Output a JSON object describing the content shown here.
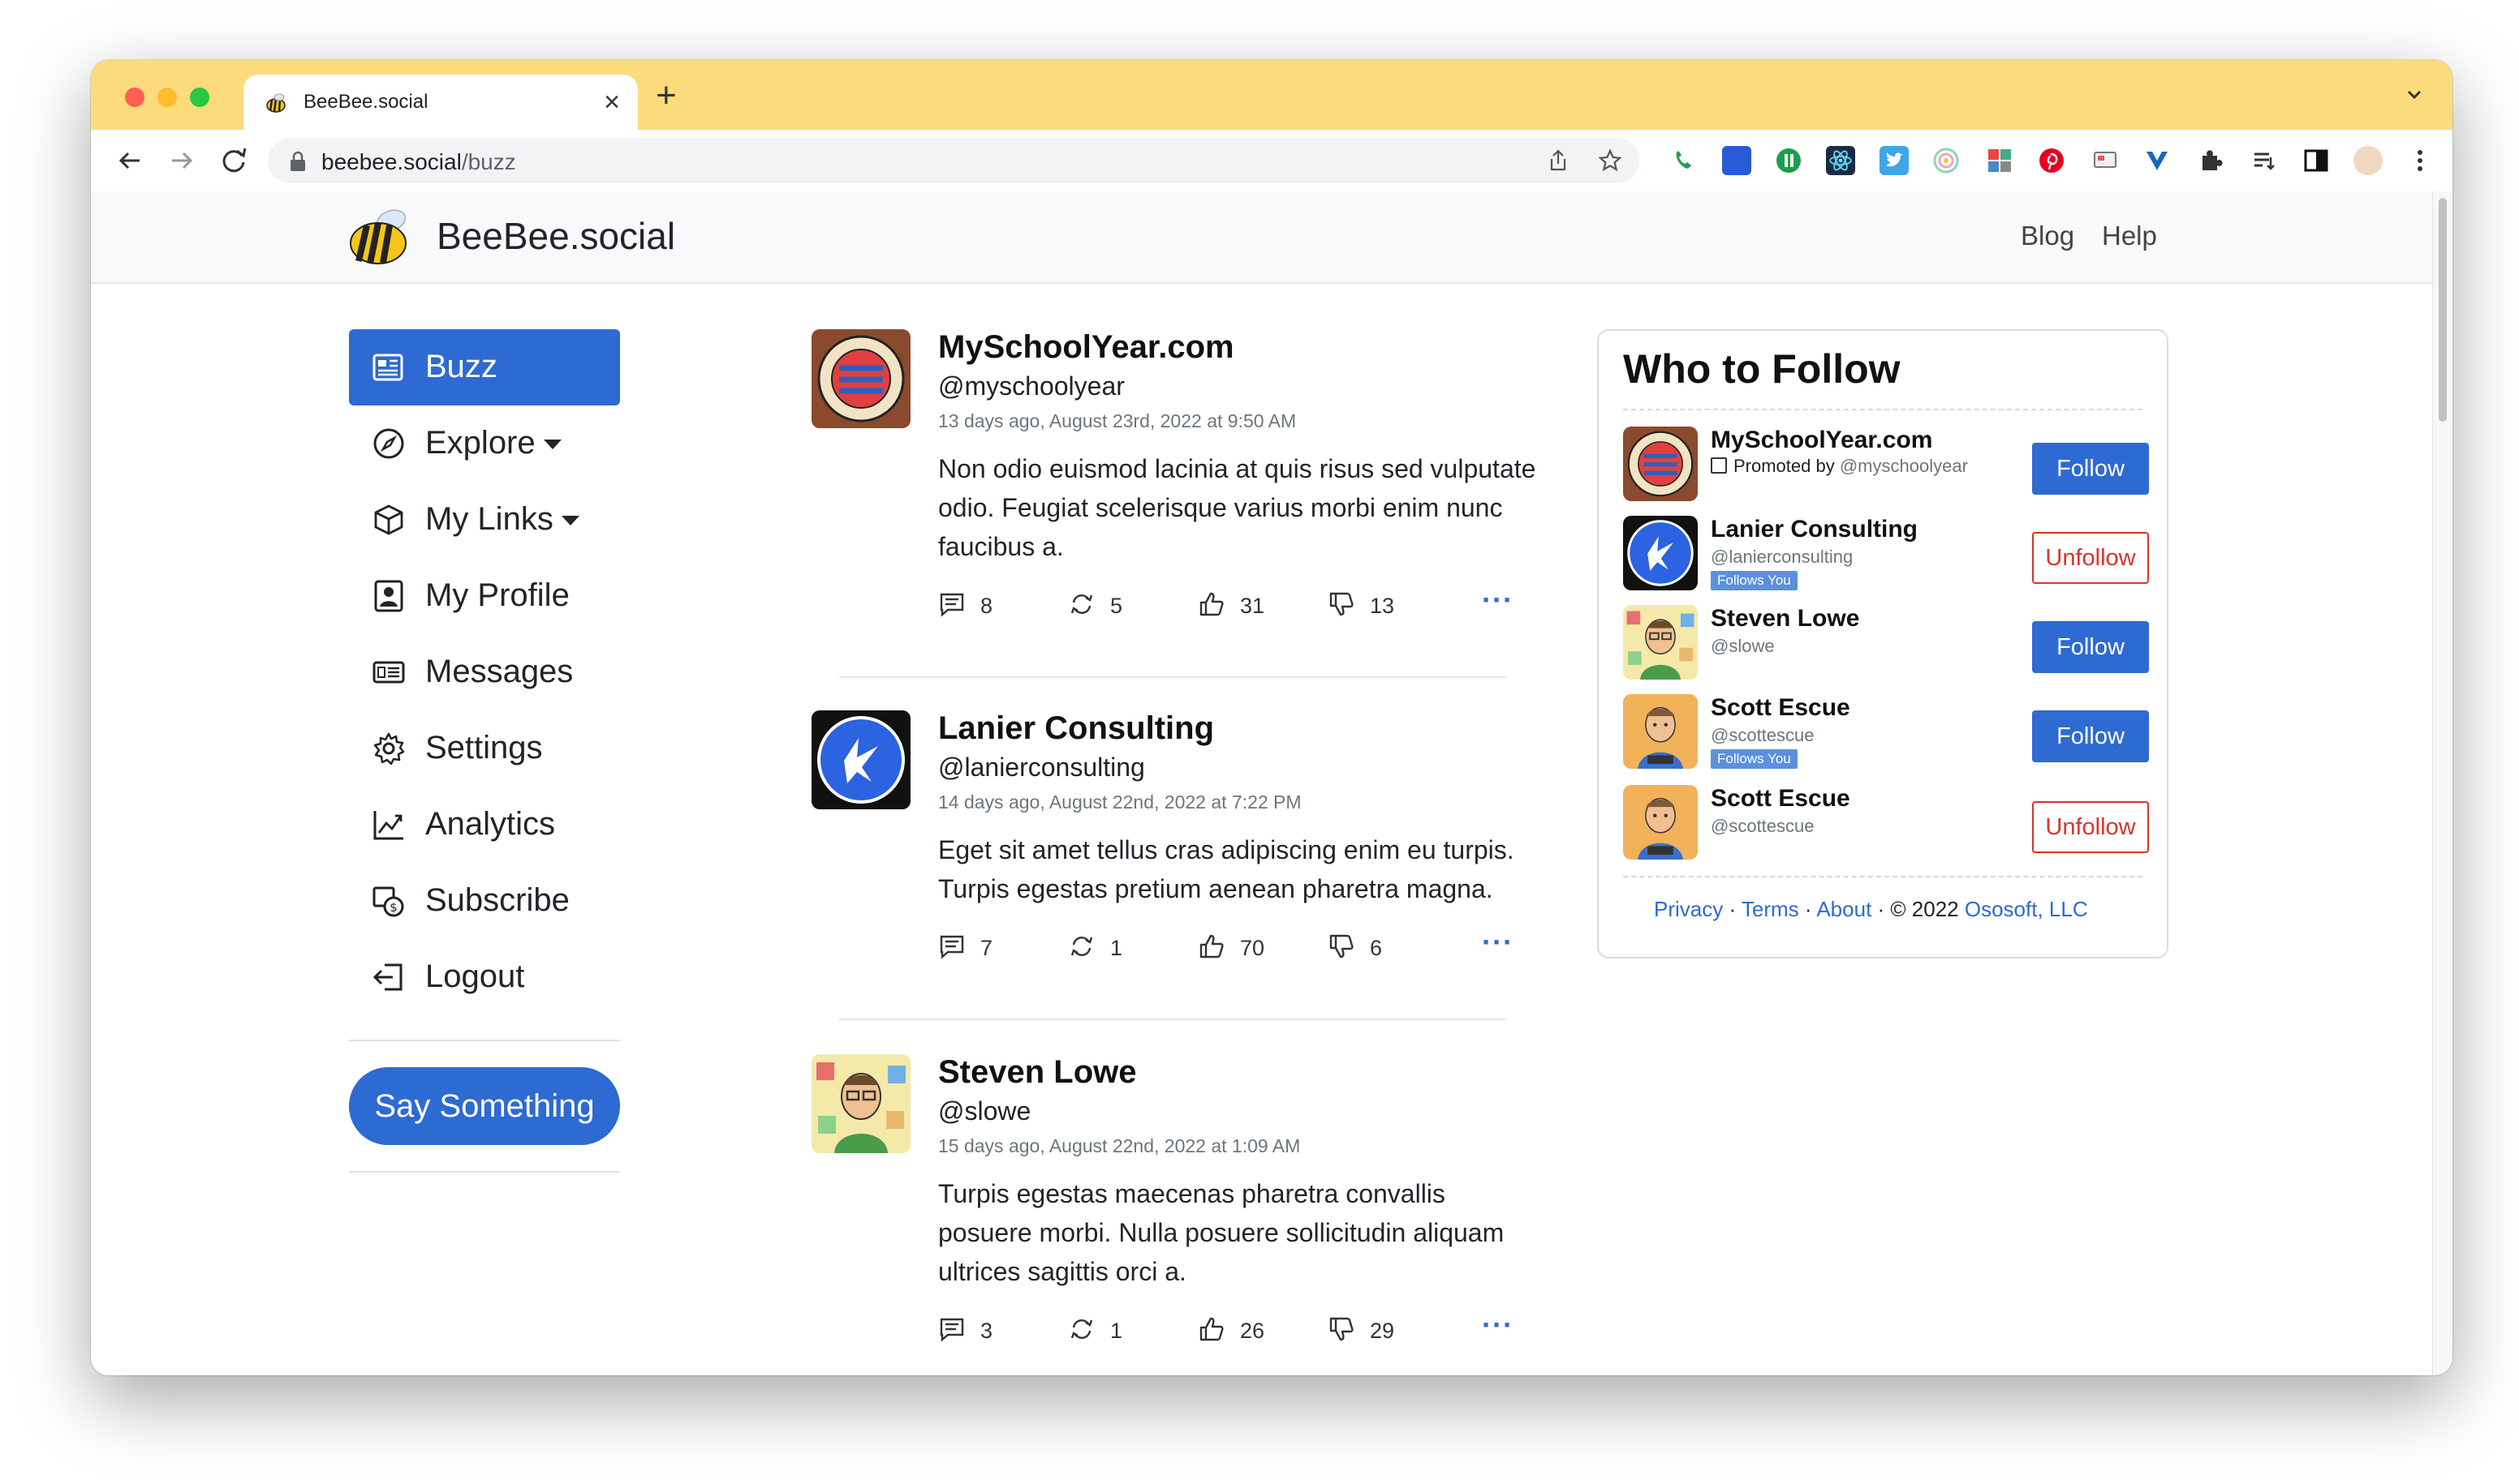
{
  "browser": {
    "tab_title": "BeeBee.social",
    "tab_close": "×",
    "new_tab": "+",
    "url_host": "beebee.social",
    "url_path": "/buzz"
  },
  "navbar": {
    "brand": "BeeBee.social",
    "links": [
      "Blog",
      "Help"
    ]
  },
  "sidebar": {
    "items": [
      {
        "label": "Buzz",
        "icon": "newspaper-icon",
        "active": true
      },
      {
        "label": "Explore",
        "icon": "compass-icon",
        "dropdown": true
      },
      {
        "label": "My Links",
        "icon": "box-icon",
        "dropdown": true
      },
      {
        "label": "My Profile",
        "icon": "person-badge-icon"
      },
      {
        "label": "Messages",
        "icon": "messages-icon"
      },
      {
        "label": "Settings",
        "icon": "gear-icon"
      },
      {
        "label": "Analytics",
        "icon": "chart-line-icon"
      },
      {
        "label": "Subscribe",
        "icon": "subscribe-icon"
      },
      {
        "label": "Logout",
        "icon": "logout-icon"
      }
    ],
    "cta": "Say Something"
  },
  "feed": {
    "posts": [
      {
        "name": "MySchoolYear.com",
        "handle": "@myschoolyear",
        "time": "13 days ago, August 23rd, 2022 at 9:50 AM",
        "body": "Non odio euismod lacinia at quis risus sed vulputate odio. Feugiat scelerisque varius morbi enim nunc faucibus a.",
        "comments": "8",
        "reposts": "5",
        "likes": "31",
        "dislikes": "13"
      },
      {
        "name": "Lanier Consulting",
        "handle": "@lanierconsulting",
        "time": "14 days ago, August 22nd, 2022 at 7:22 PM",
        "body": "Eget sit amet tellus cras adipiscing enim eu turpis. Turpis egestas pretium aenean pharetra magna.",
        "comments": "7",
        "reposts": "1",
        "likes": "70",
        "dislikes": "6"
      },
      {
        "name": "Steven Lowe",
        "handle": "@slowe",
        "time": "15 days ago, August 22nd, 2022 at 1:09 AM",
        "body": "Turpis egestas maecenas pharetra convallis posuere morbi. Nulla posuere sollicitudin aliquam ultrices sagittis orci a.",
        "comments": "3",
        "reposts": "1",
        "likes": "26",
        "dislikes": "29"
      }
    ],
    "more": "···"
  },
  "who_to_follow": {
    "title": "Who to Follow",
    "suggestions": [
      {
        "name": "MySchoolYear.com",
        "promoted_prefix": "Promoted by ",
        "handle": "@myschoolyear",
        "follows_you": "",
        "button": "Follow"
      },
      {
        "name": "Lanier Consulting",
        "handle": "@lanierconsulting",
        "follows_you": "Follows You",
        "button": "Unfollow"
      },
      {
        "name": "Steven Lowe",
        "handle": "@slowe",
        "follows_you": "",
        "button": "Follow"
      },
      {
        "name": "Scott Escue",
        "handle": "@scottescue",
        "follows_you": "Follows You",
        "button": "Follow"
      },
      {
        "name": "Scott Escue",
        "handle": "@scottescue",
        "follows_you": "",
        "button": "Unfollow"
      }
    ],
    "footer": {
      "privacy": "Privacy",
      "terms": "Terms",
      "about": "About",
      "sep": " · ",
      "copyright": "© 2022",
      "company": "Ososoft, LLC"
    }
  },
  "colors": {
    "tab_bar": "#fbdb7b",
    "primary": "#2d6ad2",
    "danger": "#d9342b"
  }
}
